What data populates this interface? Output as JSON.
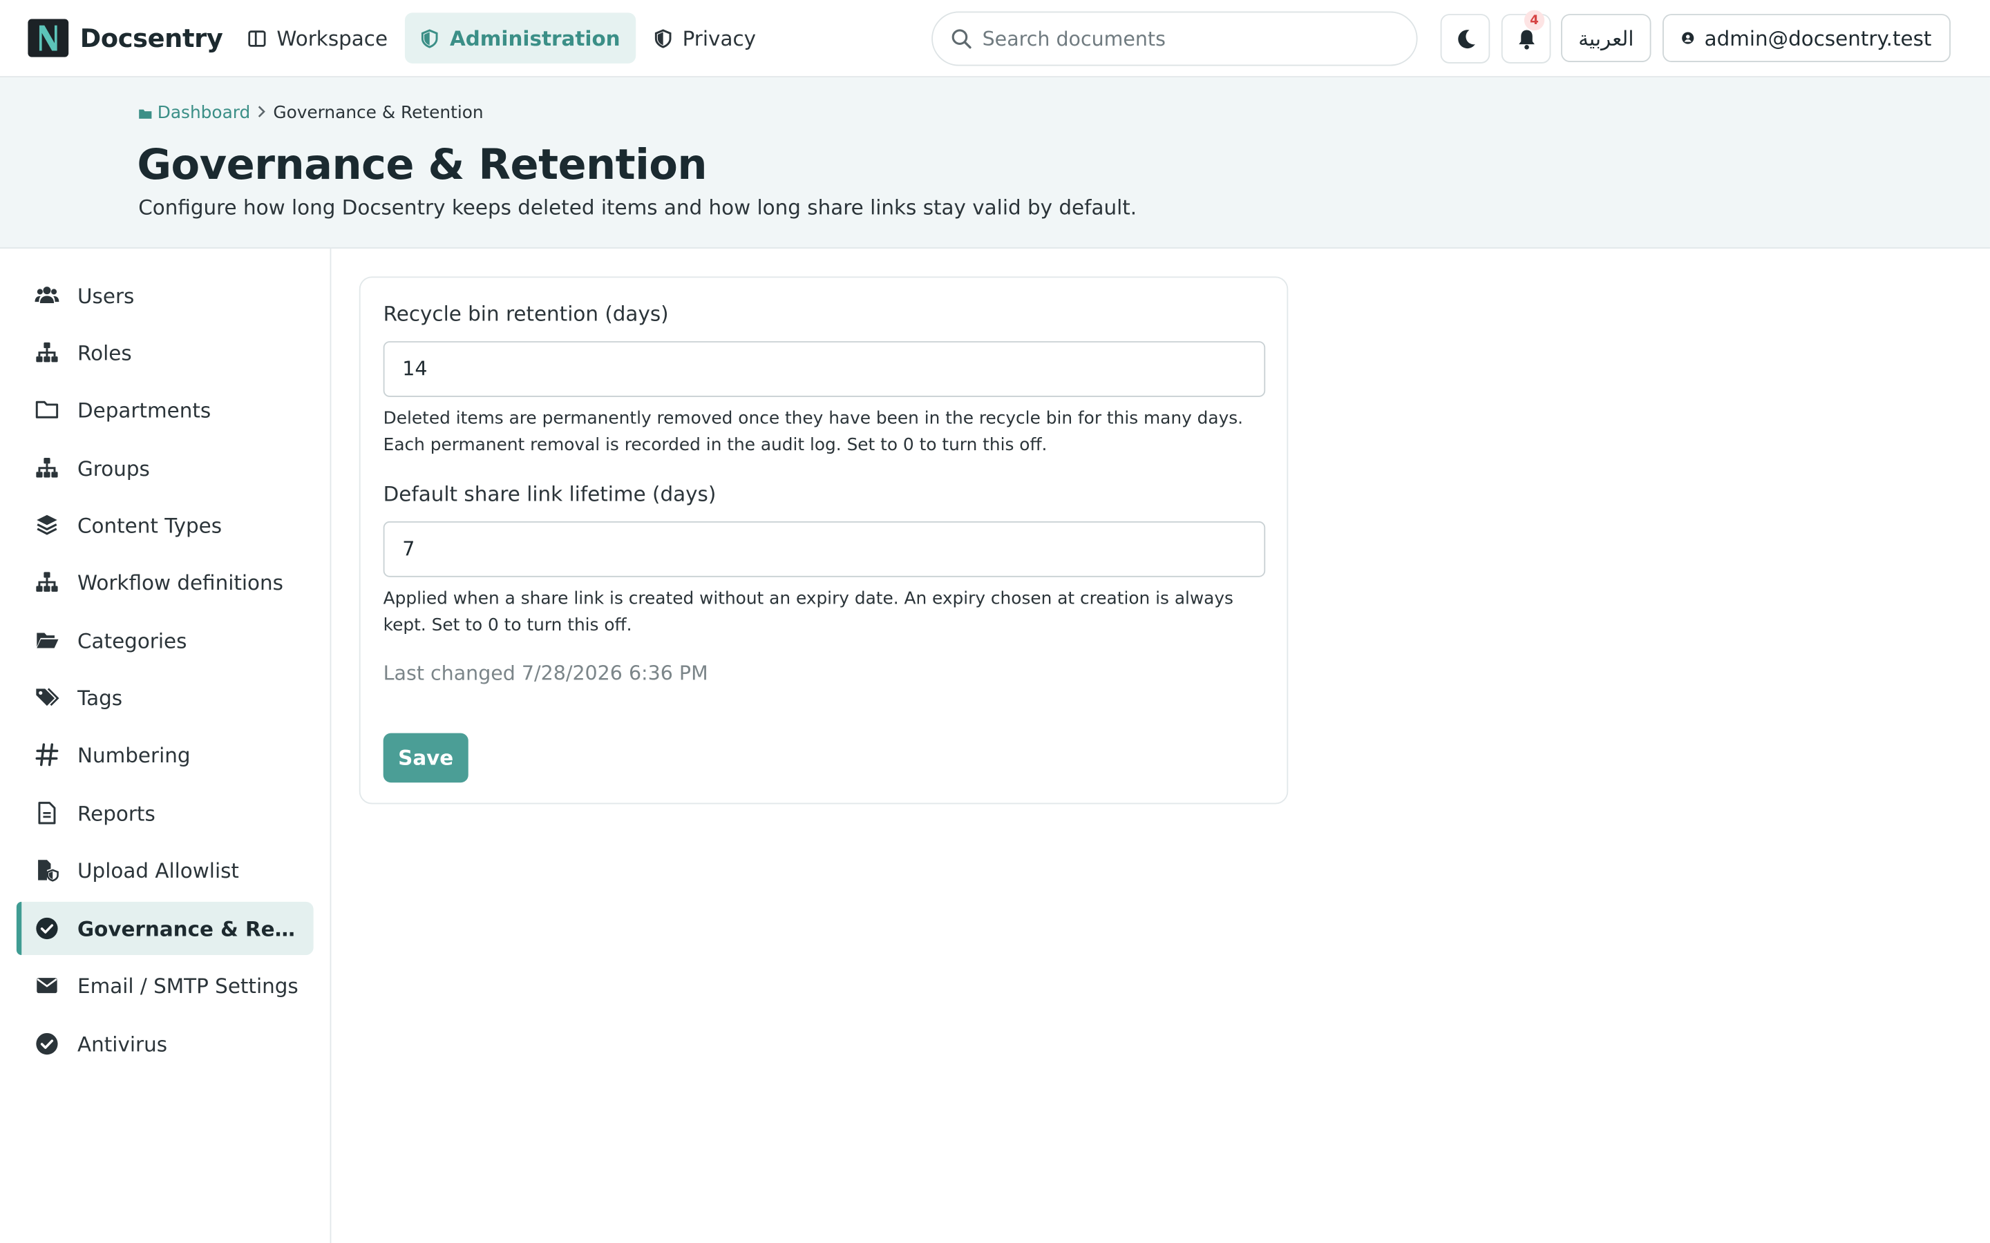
{
  "brand": {
    "name": "Docsentry"
  },
  "nav": [
    {
      "label": "Workspace"
    },
    {
      "label": "Administration"
    },
    {
      "label": "Privacy"
    }
  ],
  "search": {
    "placeholder": "Search documents",
    "value": ""
  },
  "notifications": {
    "count": "4"
  },
  "language": {
    "label": "العربية"
  },
  "account": {
    "email": "admin@docsentry.test"
  },
  "breadcrumb": {
    "root": "Dashboard",
    "current": "Governance & Retention"
  },
  "page": {
    "title": "Governance & Retention",
    "subtitle": "Configure how long Docsentry keeps deleted items and how long share links stay valid by default."
  },
  "sidebar": {
    "items": [
      {
        "label": "Users",
        "icon": "users-icon"
      },
      {
        "label": "Roles",
        "icon": "hierarchy-icon"
      },
      {
        "label": "Departments",
        "icon": "folder-icon"
      },
      {
        "label": "Groups",
        "icon": "hierarchy-icon"
      },
      {
        "label": "Content Types",
        "icon": "layers-icon"
      },
      {
        "label": "Workflow definitions",
        "icon": "hierarchy-icon"
      },
      {
        "label": "Categories",
        "icon": "folder-open-icon"
      },
      {
        "label": "Tags",
        "icon": "tags-icon"
      },
      {
        "label": "Numbering",
        "icon": "hash-icon"
      },
      {
        "label": "Reports",
        "icon": "document-icon"
      },
      {
        "label": "Upload Allowlist",
        "icon": "file-shield-icon"
      },
      {
        "label": "Governance & Retention",
        "icon": "check-circle-icon",
        "active": true
      },
      {
        "label": "Email / SMTP Settings",
        "icon": "envelope-icon"
      },
      {
        "label": "Antivirus",
        "icon": "check-circle-icon"
      }
    ]
  },
  "form": {
    "recycle": {
      "label": "Recycle bin retention (days)",
      "value": "14",
      "help": "Deleted items are permanently removed once they have been in the recycle bin for this many days. Each permanent removal is recorded in the audit log. Set to 0 to turn this off."
    },
    "share": {
      "label": "Default share link lifetime (days)",
      "value": "7",
      "help": "Applied when a share link is created without an expiry date. An expiry chosen at creation is always kept. Set to 0 to turn this off."
    },
    "last_changed": "Last changed 7/28/2026 6:36 PM",
    "save_label": "Save"
  },
  "colors": {
    "accent": "#4b9e96",
    "accent_text": "#3b8f87",
    "active_bg": "#e4f0ef"
  }
}
